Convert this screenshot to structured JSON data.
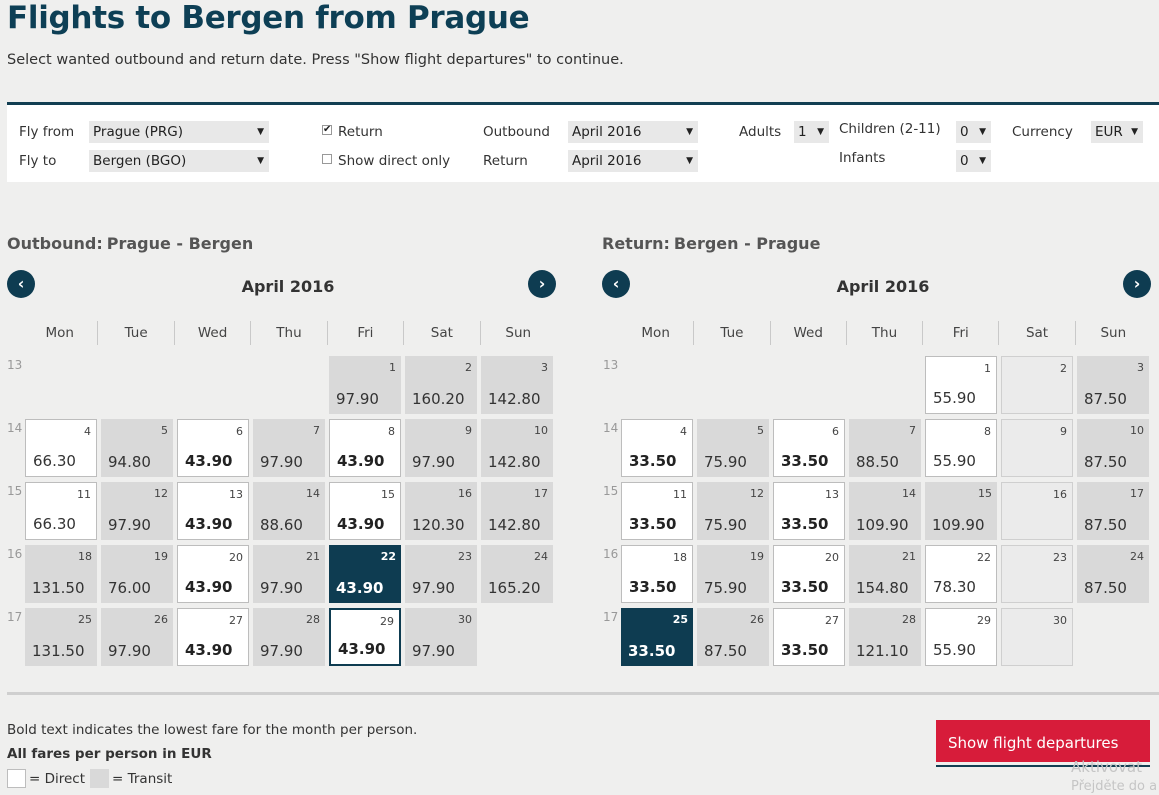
{
  "page": {
    "title": "Flights to Bergen from Prague",
    "subtitle": "Select wanted outbound and return date. Press \"Show flight departures\" to continue."
  },
  "search": {
    "fly_from_label": "Fly from",
    "fly_from_value": "Prague (PRG)",
    "fly_to_label": "Fly to",
    "fly_to_value": "Bergen (BGO)",
    "return_label": "Return",
    "return_checked": true,
    "direct_only_label": "Show direct only",
    "direct_only_checked": false,
    "outbound_label": "Outbound",
    "outbound_value": "April 2016",
    "return_month_label": "Return",
    "return_month_value": "April 2016",
    "adults_label": "Adults",
    "adults_value": "1",
    "children_label": "Children (2-11)",
    "children_value": "0",
    "infants_label": "Infants",
    "infants_value": "0",
    "currency_label": "Currency",
    "currency_value": "EUR",
    "caret": "▼",
    "check_mark": "✔"
  },
  "weekdays": [
    "Mon",
    "Tue",
    "Wed",
    "Thu",
    "Fri",
    "Sat",
    "Sun"
  ],
  "outbound": {
    "heading": "Outbound:",
    "route": "Prague - Bergen",
    "month": "April 2016",
    "prev_icon": "‹",
    "next_icon": "›",
    "weeks": [
      "13",
      "14",
      "15",
      "16",
      "17"
    ],
    "days": [
      {
        "d": "1",
        "p": "97.90",
        "t": "transit",
        "b": false,
        "w": 0,
        "c": 4
      },
      {
        "d": "2",
        "p": "160.20",
        "t": "transit",
        "b": false,
        "w": 0,
        "c": 5
      },
      {
        "d": "3",
        "p": "142.80",
        "t": "transit",
        "b": false,
        "w": 0,
        "c": 6
      },
      {
        "d": "4",
        "p": "66.30",
        "t": "direct",
        "b": false,
        "w": 1,
        "c": 0
      },
      {
        "d": "5",
        "p": "94.80",
        "t": "transit",
        "b": false,
        "w": 1,
        "c": 1
      },
      {
        "d": "6",
        "p": "43.90",
        "t": "direct",
        "b": true,
        "w": 1,
        "c": 2
      },
      {
        "d": "7",
        "p": "97.90",
        "t": "transit",
        "b": false,
        "w": 1,
        "c": 3
      },
      {
        "d": "8",
        "p": "43.90",
        "t": "direct",
        "b": true,
        "w": 1,
        "c": 4
      },
      {
        "d": "9",
        "p": "97.90",
        "t": "transit",
        "b": false,
        "w": 1,
        "c": 5
      },
      {
        "d": "10",
        "p": "142.80",
        "t": "transit",
        "b": false,
        "w": 1,
        "c": 6
      },
      {
        "d": "11",
        "p": "66.30",
        "t": "direct",
        "b": false,
        "w": 2,
        "c": 0
      },
      {
        "d": "12",
        "p": "97.90",
        "t": "transit",
        "b": false,
        "w": 2,
        "c": 1
      },
      {
        "d": "13",
        "p": "43.90",
        "t": "direct",
        "b": true,
        "w": 2,
        "c": 2
      },
      {
        "d": "14",
        "p": "88.60",
        "t": "transit",
        "b": false,
        "w": 2,
        "c": 3
      },
      {
        "d": "15",
        "p": "43.90",
        "t": "direct",
        "b": true,
        "w": 2,
        "c": 4
      },
      {
        "d": "16",
        "p": "120.30",
        "t": "transit",
        "b": false,
        "w": 2,
        "c": 5
      },
      {
        "d": "17",
        "p": "142.80",
        "t": "transit",
        "b": false,
        "w": 2,
        "c": 6
      },
      {
        "d": "18",
        "p": "131.50",
        "t": "transit",
        "b": false,
        "w": 3,
        "c": 0
      },
      {
        "d": "19",
        "p": "76.00",
        "t": "transit",
        "b": false,
        "w": 3,
        "c": 1
      },
      {
        "d": "20",
        "p": "43.90",
        "t": "direct",
        "b": true,
        "w": 3,
        "c": 2
      },
      {
        "d": "21",
        "p": "97.90",
        "t": "transit",
        "b": false,
        "w": 3,
        "c": 3
      },
      {
        "d": "22",
        "p": "43.90",
        "t": "selected",
        "b": true,
        "w": 3,
        "c": 4
      },
      {
        "d": "23",
        "p": "97.90",
        "t": "transit",
        "b": false,
        "w": 3,
        "c": 5
      },
      {
        "d": "24",
        "p": "165.20",
        "t": "transit",
        "b": false,
        "w": 3,
        "c": 6
      },
      {
        "d": "25",
        "p": "131.50",
        "t": "transit",
        "b": false,
        "w": 4,
        "c": 0
      },
      {
        "d": "26",
        "p": "97.90",
        "t": "transit",
        "b": false,
        "w": 4,
        "c": 1
      },
      {
        "d": "27",
        "p": "43.90",
        "t": "direct",
        "b": true,
        "w": 4,
        "c": 2
      },
      {
        "d": "28",
        "p": "97.90",
        "t": "transit",
        "b": false,
        "w": 4,
        "c": 3
      },
      {
        "d": "29",
        "p": "43.90",
        "t": "selected-outline",
        "b": true,
        "w": 4,
        "c": 4
      },
      {
        "d": "30",
        "p": "97.90",
        "t": "transit",
        "b": false,
        "w": 4,
        "c": 5
      }
    ]
  },
  "return": {
    "heading": "Return:",
    "route": "Bergen - Prague",
    "month": "April 2016",
    "prev_icon": "‹",
    "next_icon": "›",
    "weeks": [
      "13",
      "14",
      "15",
      "16",
      "17"
    ],
    "days": [
      {
        "d": "1",
        "p": "55.90",
        "t": "direct",
        "b": false,
        "w": 0,
        "c": 4
      },
      {
        "d": "2",
        "p": "",
        "t": "empty",
        "b": false,
        "w": 0,
        "c": 5
      },
      {
        "d": "3",
        "p": "87.50",
        "t": "transit",
        "b": false,
        "w": 0,
        "c": 6
      },
      {
        "d": "4",
        "p": "33.50",
        "t": "direct",
        "b": true,
        "w": 1,
        "c": 0
      },
      {
        "d": "5",
        "p": "75.90",
        "t": "transit",
        "b": false,
        "w": 1,
        "c": 1
      },
      {
        "d": "6",
        "p": "33.50",
        "t": "direct",
        "b": true,
        "w": 1,
        "c": 2
      },
      {
        "d": "7",
        "p": "88.50",
        "t": "transit",
        "b": false,
        "w": 1,
        "c": 3
      },
      {
        "d": "8",
        "p": "55.90",
        "t": "direct",
        "b": false,
        "w": 1,
        "c": 4
      },
      {
        "d": "9",
        "p": "",
        "t": "empty",
        "b": false,
        "w": 1,
        "c": 5
      },
      {
        "d": "10",
        "p": "87.50",
        "t": "transit",
        "b": false,
        "w": 1,
        "c": 6
      },
      {
        "d": "11",
        "p": "33.50",
        "t": "direct",
        "b": true,
        "w": 2,
        "c": 0
      },
      {
        "d": "12",
        "p": "75.90",
        "t": "transit",
        "b": false,
        "w": 2,
        "c": 1
      },
      {
        "d": "13",
        "p": "33.50",
        "t": "direct",
        "b": true,
        "w": 2,
        "c": 2
      },
      {
        "d": "14",
        "p": "109.90",
        "t": "transit",
        "b": false,
        "w": 2,
        "c": 3
      },
      {
        "d": "15",
        "p": "109.90",
        "t": "transit",
        "b": false,
        "w": 2,
        "c": 4
      },
      {
        "d": "16",
        "p": "",
        "t": "empty",
        "b": false,
        "w": 2,
        "c": 5
      },
      {
        "d": "17",
        "p": "87.50",
        "t": "transit",
        "b": false,
        "w": 2,
        "c": 6
      },
      {
        "d": "18",
        "p": "33.50",
        "t": "direct",
        "b": true,
        "w": 3,
        "c": 0
      },
      {
        "d": "19",
        "p": "75.90",
        "t": "transit",
        "b": false,
        "w": 3,
        "c": 1
      },
      {
        "d": "20",
        "p": "33.50",
        "t": "direct",
        "b": true,
        "w": 3,
        "c": 2
      },
      {
        "d": "21",
        "p": "154.80",
        "t": "transit",
        "b": false,
        "w": 3,
        "c": 3
      },
      {
        "d": "22",
        "p": "78.30",
        "t": "direct",
        "b": false,
        "w": 3,
        "c": 4
      },
      {
        "d": "23",
        "p": "",
        "t": "empty",
        "b": false,
        "w": 3,
        "c": 5
      },
      {
        "d": "24",
        "p": "87.50",
        "t": "transit",
        "b": false,
        "w": 3,
        "c": 6
      },
      {
        "d": "25",
        "p": "33.50",
        "t": "selected",
        "b": true,
        "w": 4,
        "c": 0
      },
      {
        "d": "26",
        "p": "87.50",
        "t": "transit",
        "b": false,
        "w": 4,
        "c": 1
      },
      {
        "d": "27",
        "p": "33.50",
        "t": "direct",
        "b": true,
        "w": 4,
        "c": 2
      },
      {
        "d": "28",
        "p": "121.10",
        "t": "transit",
        "b": false,
        "w": 4,
        "c": 3
      },
      {
        "d": "29",
        "p": "55.90",
        "t": "direct",
        "b": false,
        "w": 4,
        "c": 4
      },
      {
        "d": "30",
        "p": "",
        "t": "empty",
        "b": false,
        "w": 4,
        "c": 5
      }
    ]
  },
  "footer": {
    "bold_note": "Bold text indicates the lowest fare for the month per person.",
    "fares_note": "All fares per person in EUR",
    "legend_direct": "= Direct",
    "legend_transit": "= Transit",
    "cta_label": "Show flight departures",
    "watermark_1": "Aktivovat",
    "watermark_2": "Přejděte do a"
  },
  "colors": {
    "brand_dark": "#0e3c51",
    "cta_red": "#d71c3a",
    "transit_cell": "#d9d9d9",
    "direct_cell": "#ffffff"
  }
}
